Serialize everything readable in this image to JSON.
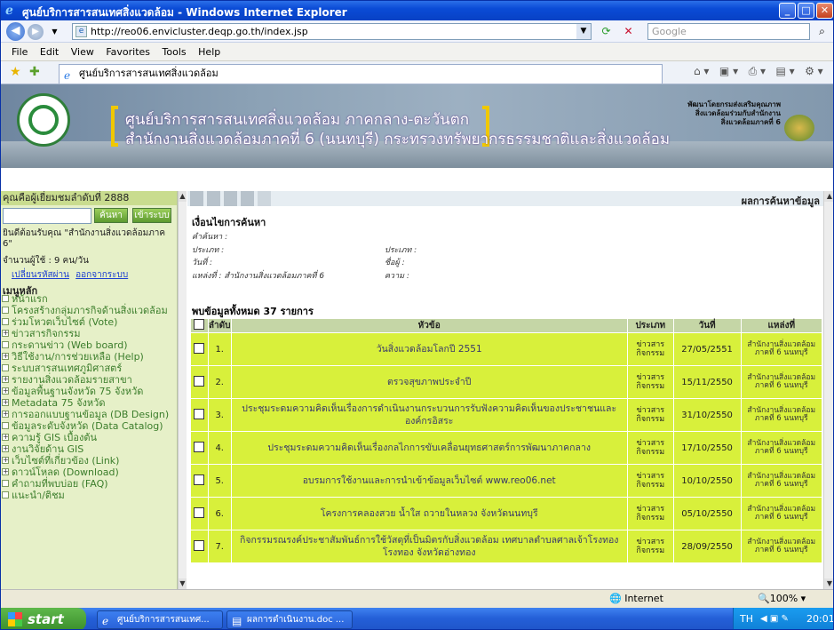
{
  "window": {
    "title": "ศูนย์บริการสารสนเทศสิ่งแวดล้อม - Windows Internet Explorer",
    "icon": "ie-icon",
    "controls": [
      "minimize",
      "maximize",
      "close"
    ]
  },
  "addressbar": {
    "url": "http://reo06.envicluster.deqp.go.th/index.jsp",
    "search_placeholder": "Google"
  },
  "menubar": {
    "items": [
      "File",
      "Edit",
      "View",
      "Favorites",
      "Tools",
      "Help"
    ]
  },
  "favbar": {
    "tab_title": "ศูนย์บริการสารสนเทศสิ่งแวดล้อม"
  },
  "banner": {
    "line1": "ศูนย์บริการสารสนเทศสิ่งแวดล้อม ภาคกลาง-ตะวันตก",
    "line2": "สำนักงานสิ่งแวดล้อมภาคที่ 6 (นนทบุรี) กระทรวงทรัพยากรธรรมชาติและสิ่งแวดล้อม",
    "right_lines": [
      "พัฒนาโดยกรมส่งเสริมคุณภาพ",
      "สิ่งแวดล้อมร่วมกับสำนักงาน",
      "สิ่งแวดล้อมภาคที่ 6"
    ]
  },
  "sidebar": {
    "visitor": "คุณคือผู้เยี่ยมชมลำดับที่ 2888",
    "search_button": "ค้นหา",
    "login_button": "เข้าระบบ",
    "welcome": "ยินดีต้อนรับคุณ \"สำนักงานสิ่งแวดล้อมภาค 6\"",
    "users": "จำนวนผู้ใช้ : 9 คน/วัน",
    "change_password": "เปลี่ยนรหัสผ่าน",
    "logout": "ออกจากระบบ",
    "menu_title": "เมนูหลัก",
    "menu": [
      {
        "box": "",
        "label": "หน้าแรก"
      },
      {
        "box": "",
        "label": "โครงสร้างกลุ่มภารกิจด้านสิ่งแวดล้อม"
      },
      {
        "box": "",
        "label": "ร่วมโหวตเว็บไซต์ (Vote)"
      },
      {
        "box": "+",
        "label": "ข่าวสารกิจกรรม"
      },
      {
        "box": "",
        "label": "กระดานข่าว (Web board)"
      },
      {
        "box": "+",
        "label": "วิธีใช้งาน/การช่วยเหลือ (Help)"
      },
      {
        "box": "",
        "label": "ระบบสารสนเทศภูมิศาสตร์"
      },
      {
        "box": "+",
        "label": "รายงานสิ่งแวดล้อมรายสาขา"
      },
      {
        "box": "+",
        "label": "ข้อมูลพื้นฐานจังหวัด 75 จังหวัด"
      },
      {
        "box": "+",
        "label": "Metadata 75 จังหวัด"
      },
      {
        "box": "+",
        "label": "การออกแบบฐานข้อมูล (DB Design)"
      },
      {
        "box": "",
        "label": "ข้อมูลระดับจังหวัด (Data Catalog)"
      },
      {
        "box": "+",
        "label": "ความรู้ GIS เบื้องต้น"
      },
      {
        "box": "+",
        "label": "งานวิจัยด้าน GIS"
      },
      {
        "box": "+",
        "label": "เว็บไซต์ที่เกี่ยวข้อง (Link)"
      },
      {
        "box": "+",
        "label": "ดาวน์โหลด (Download)"
      },
      {
        "box": "",
        "label": "คำถามที่พบบ่อย (FAQ)"
      },
      {
        "box": "",
        "label": "แนะนำ/ติชม"
      }
    ]
  },
  "main": {
    "header_title": "ผลการค้นหาข้อมูล",
    "conditions_title": "เงื่อนไขการค้นหา",
    "cond_keyword": "คำค้นหา :",
    "cond_type": "ประเภท :",
    "cond_type2": "ประเภท :",
    "cond_date": "วันที่ :",
    "cond_subject": "ชื่อผู้ :",
    "cond_source": "แหล่งที่ : สำนักงานสิ่งแวดล้อมภาคที่ 6",
    "cond_content": "ความ :",
    "count": "พบข้อมูลทั้งหมด 37 รายการ",
    "columns": {
      "no": "ลำดับ",
      "title": "หัวข้อ",
      "type": "ประเภท",
      "date": "วันที่",
      "source": "แหล่งที่"
    },
    "rows": [
      {
        "no": "1.",
        "title": "วันสิ่งแวดล้อมโลกปี 2551",
        "type": "ข่าวสาร\nกิจกรรม",
        "date": "27/05/2551",
        "source": "สำนักงานสิ่งแวดล้อมภาคที่ 6 นนทบุรี"
      },
      {
        "no": "2.",
        "title": "ตรวจสุขภาพประจำปี",
        "type": "ข่าวสาร\nกิจกรรม",
        "date": "15/11/2550",
        "source": "สำนักงานสิ่งแวดล้อมภาคที่ 6 นนทบุรี"
      },
      {
        "no": "3.",
        "title": "ประชุมระดมความคิดเห็นเรื่องการดำเนินงานกระบวนการรับฟังความคิดเห็นของประชาชนและองค์กรอิสระ",
        "type": "ข่าวสาร\nกิจกรรม",
        "date": "31/10/2550",
        "source": "สำนักงานสิ่งแวดล้อมภาคที่ 6 นนทบุรี"
      },
      {
        "no": "4.",
        "title": "ประชุมระดมความคิดเห็นเรื่องกลไกการขับเคลื่อนยุทธศาสตร์การพัฒนาภาคกลาง",
        "type": "ข่าวสาร\nกิจกรรม",
        "date": "17/10/2550",
        "source": "สำนักงานสิ่งแวดล้อมภาคที่ 6 นนทบุรี"
      },
      {
        "no": "5.",
        "title": "อบรมการใช้งานและการนำเข้าข้อมูลเว็บไซต์ www.reo06.net",
        "type": "ข่าวสาร\nกิจกรรม",
        "date": "10/10/2550",
        "source": "สำนักงานสิ่งแวดล้อมภาคที่ 6 นนทบุรี"
      },
      {
        "no": "6.",
        "title": "โครงการคลองสวย น้ำใส ถวายในหลวง จังหวัดนนทบุรี",
        "type": "ข่าวสาร\nกิจกรรม",
        "date": "05/10/2550",
        "source": "สำนักงานสิ่งแวดล้อมภาคที่ 6 นนทบุรี"
      },
      {
        "no": "7.",
        "title": "กิจกรรมรณรงค์ประชาสัมพันธ์การใช้วัสดุที่เป็นมิตรกับสิ่งแวดล้อม เทศบาลตำบลศาลเจ้าโรงทอง โรงทอง จังหวัดอ่างทอง",
        "type": "ข่าวสาร\nกิจกรรม",
        "date": "28/09/2550",
        "source": "สำนักงานสิ่งแวดล้อมภาคที่ 6 นนทบุรี"
      }
    ]
  },
  "statusbar": {
    "zone": "Internet",
    "zoom": "100%"
  },
  "taskbar": {
    "start": "start",
    "tasks": [
      "ศูนย์บริการสารสนเทศ...",
      "ผลการดำเนินงาน.doc ..."
    ],
    "lang": "TH",
    "clock": "20:01"
  }
}
